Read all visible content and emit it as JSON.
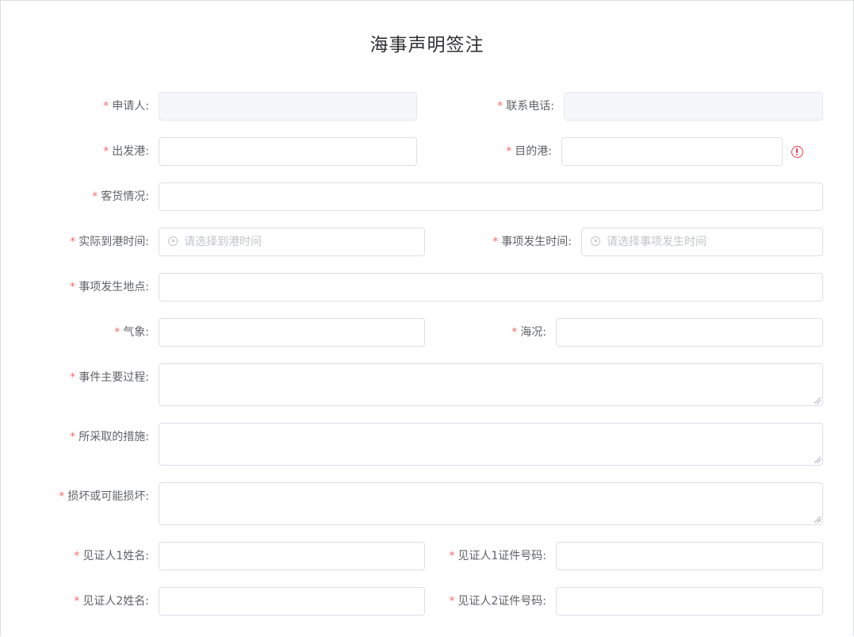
{
  "page": {
    "title": "海事声明签注"
  },
  "form": {
    "required_mark": "*",
    "applicant": {
      "label": "申请人:",
      "value": ""
    },
    "phone": {
      "label": "联系电话:",
      "value": ""
    },
    "departure_port": {
      "label": "出发港:",
      "value": ""
    },
    "destination_port": {
      "label": "目的港:",
      "value": ""
    },
    "cargo": {
      "label": "客货情况:",
      "value": ""
    },
    "arrival_time": {
      "label": "实际到港时间:",
      "placeholder": "请选择到港时间"
    },
    "event_time": {
      "label": "事项发生时间:",
      "placeholder": "请选择事项发生时间"
    },
    "event_location": {
      "label": "事项发生地点:",
      "value": ""
    },
    "weather": {
      "label": "气象:",
      "value": ""
    },
    "sea_condition": {
      "label": "海况:",
      "value": ""
    },
    "event_process": {
      "label": "事件主要过程:",
      "value": ""
    },
    "measures": {
      "label": "所采取的措施:",
      "value": ""
    },
    "damage": {
      "label": "损坏或可能损坏:",
      "value": ""
    },
    "witness1_name": {
      "label": "见证人1姓名:",
      "value": ""
    },
    "witness1_id": {
      "label": "见证人1证件号码:",
      "value": ""
    },
    "witness2_name": {
      "label": "见证人2姓名:",
      "value": ""
    },
    "witness2_id": {
      "label": "见证人2证件号码:",
      "value": ""
    }
  },
  "validation": {
    "destination_port_icon": "exclamation-circle-icon",
    "error_color": "#e8374a"
  },
  "colors": {
    "required": "#f56c6c",
    "border": "#dcdfe6",
    "disabled_bg": "#f5f7fa",
    "placeholder": "#c0c4cc"
  }
}
